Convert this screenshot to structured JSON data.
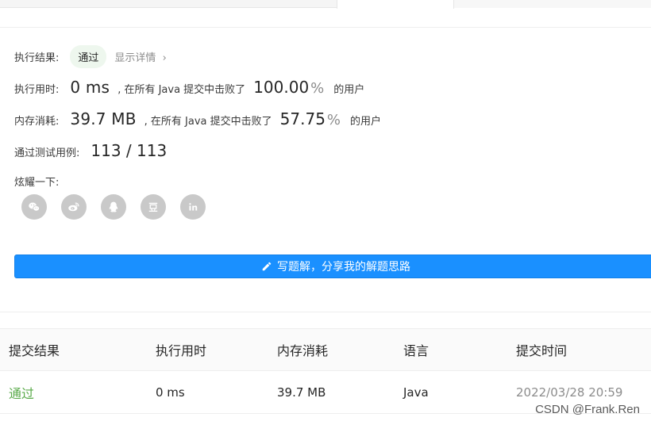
{
  "result": {
    "label": "执行结果:",
    "status": "通过",
    "details_link": "显示详情",
    "details_chevron": "›"
  },
  "runtime": {
    "label": "执行用时:",
    "value": "0 ms",
    "middle_text": ", 在所有 Java 提交中击败了",
    "percent": "100.00",
    "percent_unit": "%",
    "suffix": "的用户"
  },
  "memory": {
    "label": "内存消耗:",
    "value": "39.7 MB",
    "middle_text": ", 在所有 Java 提交中击败了",
    "percent": "57.75",
    "percent_unit": "%",
    "suffix": "的用户"
  },
  "test_cases": {
    "label": "通过测试用例:",
    "value": "113 / 113"
  },
  "share": {
    "label": "炫耀一下:",
    "icons": [
      "wechat-icon",
      "weibo-icon",
      "qq-icon",
      "douban-icon",
      "linkedin-icon"
    ]
  },
  "write_solution": {
    "label": "写题解，分享我的解题思路"
  },
  "table": {
    "headers": [
      "提交结果",
      "执行用时",
      "内存消耗",
      "语言",
      "提交时间"
    ],
    "rows": [
      [
        "通过",
        "0 ms",
        "39.7 MB",
        "Java",
        "2022/03/28 20:59"
      ]
    ]
  },
  "watermark": "CSDN @Frank.Ren",
  "colors": {
    "accent": "#1a90ff",
    "pass": "#5aaa4a",
    "icon_bg": "#c9c9c9"
  }
}
